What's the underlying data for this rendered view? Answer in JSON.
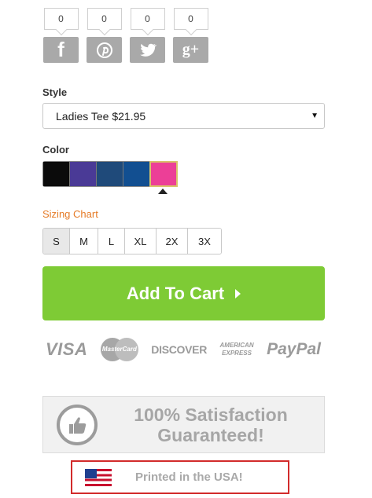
{
  "social": [
    {
      "network": "facebook",
      "count": "0",
      "icon": "facebook-icon",
      "glyph": "f"
    },
    {
      "network": "pinterest",
      "count": "0",
      "icon": "pinterest-icon"
    },
    {
      "network": "twitter",
      "count": "0",
      "icon": "twitter-icon"
    },
    {
      "network": "google-plus",
      "count": "0",
      "icon": "google-plus-icon",
      "glyph": "g+"
    }
  ],
  "style": {
    "label": "Style",
    "selected": "Ladies Tee $21.95"
  },
  "color": {
    "label": "Color",
    "swatches": [
      "#0b0b0b",
      "#4a3a96",
      "#1f4a7a",
      "#124f91",
      "#ec3f97"
    ],
    "selected_index": 4
  },
  "sizing_chart_label": "Sizing Chart",
  "sizes": [
    "S",
    "M",
    "L",
    "XL",
    "2X",
    "3X"
  ],
  "selected_size": "S",
  "cart": {
    "label": "Add To Cart"
  },
  "payments": {
    "visa": "VISA",
    "mastercard": "MasterCard",
    "discover": "DISCOVER",
    "amex_line1": "AMERICAN",
    "amex_line2": "EXPRESS",
    "paypal": "PayPal"
  },
  "guarantee": {
    "line1": "100% Satisfaction",
    "line2": "Guaranteed!"
  },
  "usa": {
    "label": "Printed in the USA!"
  }
}
